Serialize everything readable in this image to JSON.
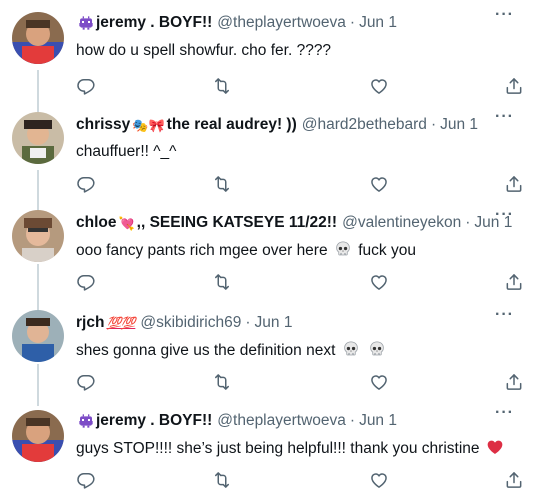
{
  "tweets": [
    {
      "name": "jeremy . BOYF!!",
      "name_emoji": "👾",
      "handle": "@theplayertwoeva",
      "date": "Jun 1",
      "text": "how do u spell showfur. cho fer. ????"
    },
    {
      "name": "chrissy",
      "name_emoji": "🎭🎀",
      "name_suffix": "the real audrey! ))",
      "handle": "@hard2bethebard",
      "date": "Jun 1",
      "text": "chauffuer!! ^_^"
    },
    {
      "name": "chloe",
      "name_emoji": "💘",
      "name_suffix": ",, SEEING KATSEYE 11/22!!",
      "handle": "@valentineyekon",
      "date": "Jun 1",
      "text_before": "ooo fancy pants rich mgee over here",
      "text_after": "fuck you"
    },
    {
      "name": "rjch",
      "name_emoji": "💯💯",
      "handle": "@skibidirich69",
      "date": "Jun 1",
      "text": "shes gonna give us the definition next"
    },
    {
      "name": "jeremy . BOYF!!",
      "name_emoji": "👾",
      "handle": "@theplayertwoeva",
      "date": "Jun 1",
      "text": "guys STOP!!!! she’s just being helpful!!! thank you christine"
    }
  ],
  "separator": "·",
  "more_label": "···",
  "icons": [
    "reply-icon",
    "retweet-icon",
    "like-icon",
    "share-icon",
    "skull-emoji",
    "heart-emoji"
  ],
  "colors": {
    "text": "#0f1419",
    "secondary": "#536471",
    "thread_line": "#cfd9de",
    "heart": "#e0245e"
  }
}
